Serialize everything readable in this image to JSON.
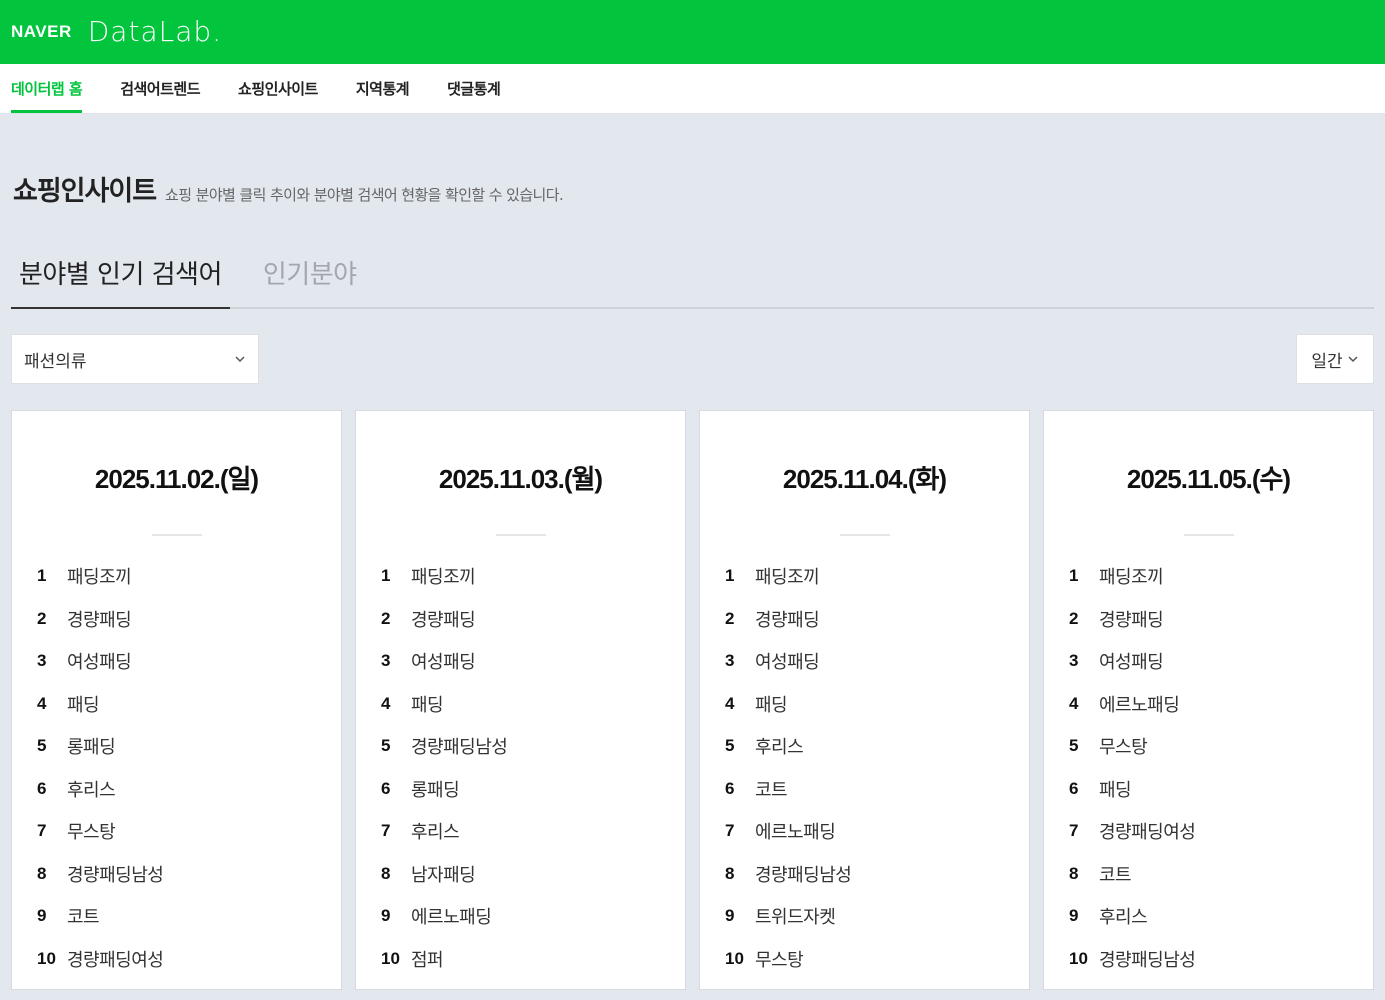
{
  "header": {
    "naver": "NAVER",
    "datalab": "DataLab."
  },
  "nav": {
    "items": [
      {
        "label": "데이터랩 홈",
        "active": true
      },
      {
        "label": "검색어트렌드",
        "active": false
      },
      {
        "label": "쇼핑인사이트",
        "active": false
      },
      {
        "label": "지역통계",
        "active": false
      },
      {
        "label": "댓글통계",
        "active": false
      }
    ]
  },
  "page": {
    "title": "쇼핑인사이트",
    "description": "쇼핑 분야별 클릭 추이와 분야별 검색어 현황을 확인할 수 있습니다."
  },
  "tabs": {
    "popular_keywords": "분야별 인기 검색어",
    "popular_categories": "인기분야"
  },
  "filters": {
    "category": {
      "selected": "패션의류",
      "icon": "chevron-down-icon"
    },
    "period": {
      "selected": "일간",
      "icon": "chevron-down-icon"
    }
  },
  "colors": {
    "brand": "#03c43d",
    "background": "#e3e8ef"
  },
  "cards": [
    {
      "date": "2025.11.02.(일)",
      "rankings": [
        {
          "rank": "1",
          "keyword": "패딩조끼"
        },
        {
          "rank": "2",
          "keyword": "경량패딩"
        },
        {
          "rank": "3",
          "keyword": "여성패딩"
        },
        {
          "rank": "4",
          "keyword": "패딩"
        },
        {
          "rank": "5",
          "keyword": "롱패딩"
        },
        {
          "rank": "6",
          "keyword": "후리스"
        },
        {
          "rank": "7",
          "keyword": "무스탕"
        },
        {
          "rank": "8",
          "keyword": "경량패딩남성"
        },
        {
          "rank": "9",
          "keyword": "코트"
        },
        {
          "rank": "10",
          "keyword": "경량패딩여성"
        }
      ]
    },
    {
      "date": "2025.11.03.(월)",
      "rankings": [
        {
          "rank": "1",
          "keyword": "패딩조끼"
        },
        {
          "rank": "2",
          "keyword": "경량패딩"
        },
        {
          "rank": "3",
          "keyword": "여성패딩"
        },
        {
          "rank": "4",
          "keyword": "패딩"
        },
        {
          "rank": "5",
          "keyword": "경량패딩남성"
        },
        {
          "rank": "6",
          "keyword": "롱패딩"
        },
        {
          "rank": "7",
          "keyword": "후리스"
        },
        {
          "rank": "8",
          "keyword": "남자패딩"
        },
        {
          "rank": "9",
          "keyword": "에르노패딩"
        },
        {
          "rank": "10",
          "keyword": "점퍼"
        }
      ]
    },
    {
      "date": "2025.11.04.(화)",
      "rankings": [
        {
          "rank": "1",
          "keyword": "패딩조끼"
        },
        {
          "rank": "2",
          "keyword": "경량패딩"
        },
        {
          "rank": "3",
          "keyword": "여성패딩"
        },
        {
          "rank": "4",
          "keyword": "패딩"
        },
        {
          "rank": "5",
          "keyword": "후리스"
        },
        {
          "rank": "6",
          "keyword": "코트"
        },
        {
          "rank": "7",
          "keyword": "에르노패딩"
        },
        {
          "rank": "8",
          "keyword": "경량패딩남성"
        },
        {
          "rank": "9",
          "keyword": "트위드자켓"
        },
        {
          "rank": "10",
          "keyword": "무스탕"
        }
      ]
    },
    {
      "date": "2025.11.05.(수)",
      "rankings": [
        {
          "rank": "1",
          "keyword": "패딩조끼"
        },
        {
          "rank": "2",
          "keyword": "경량패딩"
        },
        {
          "rank": "3",
          "keyword": "여성패딩"
        },
        {
          "rank": "4",
          "keyword": "에르노패딩"
        },
        {
          "rank": "5",
          "keyword": "무스탕"
        },
        {
          "rank": "6",
          "keyword": "패딩"
        },
        {
          "rank": "7",
          "keyword": "경량패딩여성"
        },
        {
          "rank": "8",
          "keyword": "코트"
        },
        {
          "rank": "9",
          "keyword": "후리스"
        },
        {
          "rank": "10",
          "keyword": "경량패딩남성"
        }
      ]
    }
  ]
}
